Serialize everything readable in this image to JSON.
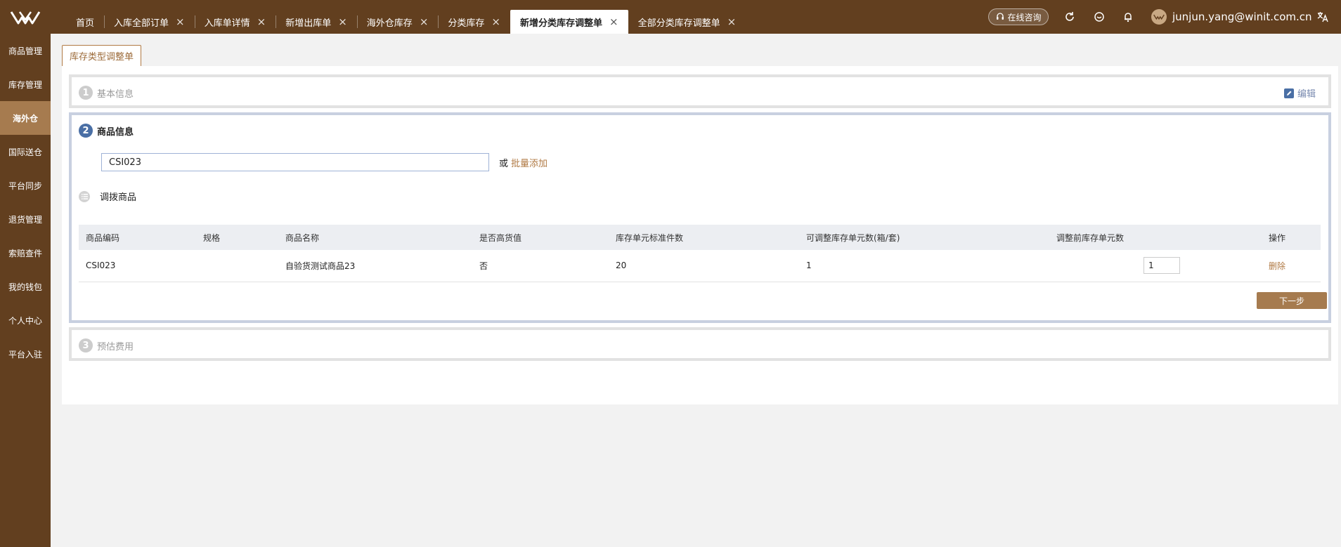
{
  "header": {
    "tabs": [
      {
        "label": "首页",
        "closable": false
      },
      {
        "label": "入库全部订单",
        "closable": true
      },
      {
        "label": "入库单详情",
        "closable": true
      },
      {
        "label": "新增出库单",
        "closable": true
      },
      {
        "label": "海外仓库存",
        "closable": true
      },
      {
        "label": "分类库存",
        "closable": true
      },
      {
        "label": "新增分类库存调整单",
        "closable": true,
        "active": true
      },
      {
        "label": "全部分类库存调整单",
        "closable": true
      }
    ],
    "close_glyph": "×",
    "consult_label": "在线咨询",
    "user_email": "junjun.yang@winit.com.cn",
    "icons": [
      "refresh-icon",
      "message-icon",
      "bell-icon",
      "translate-icon"
    ]
  },
  "sidebar": {
    "items": [
      {
        "label": "商品管理"
      },
      {
        "label": "库存管理"
      },
      {
        "label": "海外仓",
        "active": true
      },
      {
        "label": "国际送仓"
      },
      {
        "label": "平台同步"
      },
      {
        "label": "退货管理"
      },
      {
        "label": "索赔查件"
      },
      {
        "label": "我的钱包"
      },
      {
        "label": "个人中心"
      },
      {
        "label": "平台入驻"
      }
    ]
  },
  "page": {
    "tab_label": "库存类型调整单",
    "step1": {
      "num": "1",
      "title": "基本信息",
      "edit_label": "编辑"
    },
    "step2": {
      "num": "2",
      "title": "商品信息",
      "sku_input_value": "CSI023",
      "or_text": "或",
      "batch_add_label": "批量添加",
      "sub_title": "调拨商品",
      "table": {
        "headers": [
          "商品编码",
          "规格",
          "商品名称",
          "是否高货值",
          "库存单元标准件数",
          "可调整库存单元数(箱/套)",
          "调整前库存单元数",
          "操作"
        ],
        "rows": [
          {
            "code": "CSI023",
            "spec": "",
            "name": "自验货测试商品23",
            "high_value": "否",
            "std_qty": "20",
            "adjustable": "1",
            "before_qty": "1",
            "action": "删除"
          }
        ]
      },
      "next_label": "下一步"
    },
    "step3": {
      "num": "3",
      "title": "预估费用"
    }
  },
  "colors": {
    "brand": "#623f1f",
    "accent": "#a67b4f",
    "link": "#b07a44",
    "step_active": "#4a6fa5"
  }
}
